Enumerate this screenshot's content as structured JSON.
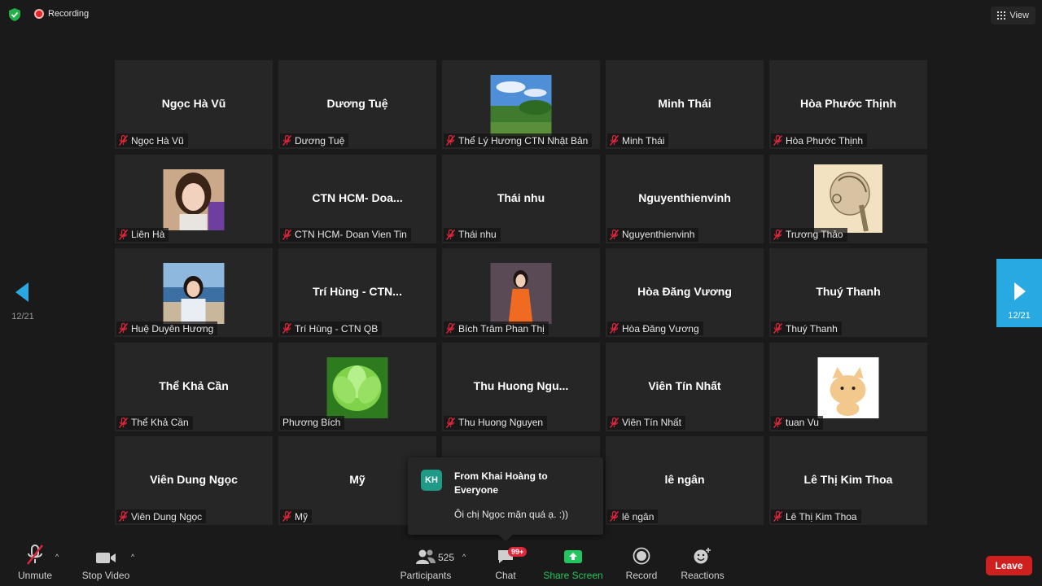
{
  "topbar": {
    "recording_label": "Recording",
    "view_label": "View"
  },
  "pagination": {
    "left": "12/21",
    "right": "12/21"
  },
  "tiles": [
    {
      "name": "Ngọc Hà Vũ",
      "label": "Ngọc Hà Vũ",
      "muted": true
    },
    {
      "name": "Dương Tuệ",
      "label": "Dương Tuệ",
      "muted": true
    },
    {
      "photo": "landscape",
      "label": "Thể Lý Hương CTN Nhật Bản",
      "muted": true
    },
    {
      "name": "Minh Thái",
      "label": "Minh Thái",
      "muted": true
    },
    {
      "name": "Hòa Phước Thịnh",
      "label": "Hòa Phước Thịnh",
      "muted": true
    },
    {
      "photo": "woman-portrait",
      "label": "Liên Hà",
      "muted": true
    },
    {
      "name": "CTN  HCM-  Doa...",
      "label": "CTN HCM- Doan Vien Tin",
      "muted": true
    },
    {
      "name": "Thái nhu",
      "label": "Thái nhu",
      "muted": true
    },
    {
      "name": "Nguyenthienvinh",
      "label": "Nguyenthienvinh",
      "muted": true
    },
    {
      "photo": "sketch",
      "label": "Trương Thảo",
      "muted": true
    },
    {
      "photo": "woman-sea",
      "label": "Huệ Duyên Hương",
      "muted": true
    },
    {
      "name": "Trí Hùng  - CTN...",
      "label": "Trí Hùng - CTN QB",
      "muted": true
    },
    {
      "photo": "woman-red-dress",
      "label": "Bích Trâm Phan Thị",
      "muted": true
    },
    {
      "name": "Hòa Đăng Vương",
      "label": "Hòa Đăng Vương",
      "muted": true
    },
    {
      "name": "Thuý Thanh",
      "label": "Thuý Thanh",
      "muted": true
    },
    {
      "name": "Thể Khả Cần",
      "label": "Thể Khả Cần",
      "muted": true
    },
    {
      "photo": "lotus",
      "label": "Phương Bích",
      "muted": false
    },
    {
      "name": "Thu  Huong  Ngu...",
      "label": "Thu Huong Nguyen",
      "muted": true
    },
    {
      "name": "Viên Tín Nhất",
      "label": "Viên Tín Nhất",
      "muted": true
    },
    {
      "photo": "cartoon-cat",
      "label": "tuan Vu",
      "muted": true
    },
    {
      "name": "Viên Dung Ngọc",
      "label": "Viên Dung Ngọc",
      "muted": true
    },
    {
      "name": "Mỹ",
      "label": "Mỹ",
      "muted": true
    },
    {
      "name": "",
      "label": "",
      "muted": false
    },
    {
      "name": "lê ngân",
      "label": "lê ngân",
      "muted": true
    },
    {
      "name": "Lê Thị Kim Thoa",
      "label": "Lê Thị Kim Thoa",
      "muted": true
    }
  ],
  "chat_popup": {
    "initials": "KH",
    "from": "From Khai Hoàng to Everyone",
    "message": "Ôi chị Ngọc mặn quá ạ. :))"
  },
  "toolbar": {
    "unmute": "Unmute",
    "stop_video": "Stop Video",
    "participants": "Participants",
    "participant_count": "525",
    "chat": "Chat",
    "chat_badge": "99+",
    "share_screen": "Share Screen",
    "record": "Record",
    "reactions": "Reactions",
    "leave": "Leave"
  },
  "colors": {
    "background": "#1a1a1a",
    "tile": "#262626",
    "accent_blue": "#29a9e1",
    "share_green": "#22c55e",
    "leave_red": "#cf1f1f",
    "muted_red": "#e0263a"
  }
}
